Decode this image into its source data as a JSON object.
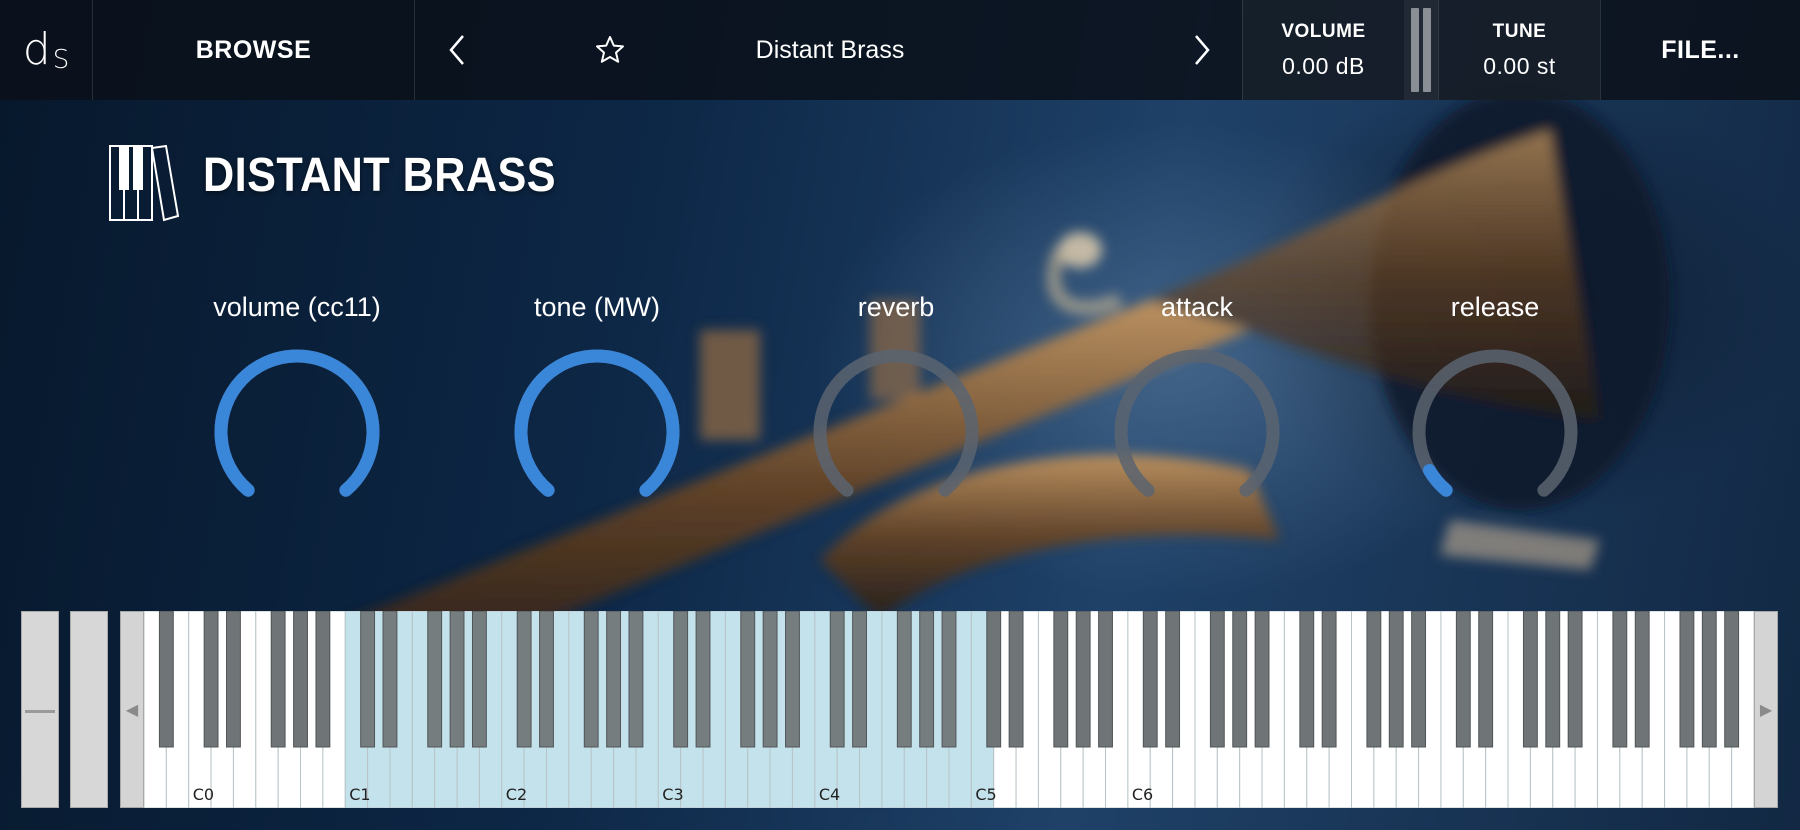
{
  "app": {
    "logo_text": "d",
    "logo_sub": "S"
  },
  "topbar": {
    "browse_label": "BROWSE",
    "preset_name": "Distant Brass",
    "volume_label": "VOLUME",
    "volume_value": "0.00 dB",
    "tune_label": "TUNE",
    "tune_value": "0.00 st",
    "file_label": "FILE..."
  },
  "instrument": {
    "title": "DISTANT BRASS"
  },
  "knobs": [
    {
      "label": "volume (cc11)",
      "value": 1.0
    },
    {
      "label": "tone (MW)",
      "value": 1.0
    },
    {
      "label": "reverb",
      "value": 0.0
    },
    {
      "label": "attack",
      "value": 0.0
    },
    {
      "label": "release",
      "value": 0.07
    }
  ],
  "keyboard": {
    "octave_labels": [
      "C0",
      "C1",
      "C2",
      "C3",
      "C4",
      "C5",
      "C6"
    ],
    "range_start": "C1",
    "range_end": "C5"
  },
  "colors": {
    "accent": "#3a86d9",
    "knob_track": "#5a6470",
    "key_range": "#c4e2eb",
    "black_key": "#6f7477",
    "black_key_in_range": "#767d7f"
  },
  "icons": {
    "prev": "chevron-left-icon",
    "next": "chevron-right-icon",
    "favorite": "star-icon",
    "instrument": "piano-keys-icon"
  }
}
